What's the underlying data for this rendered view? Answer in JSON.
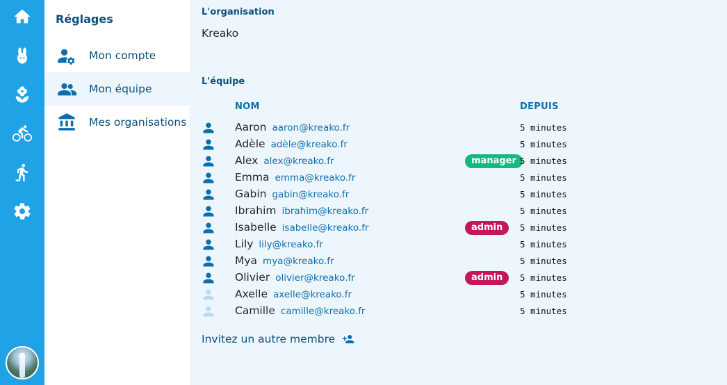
{
  "rail": {
    "items": [
      {
        "name": "home-icon"
      },
      {
        "name": "rabbit-icon"
      },
      {
        "name": "flower-icon"
      },
      {
        "name": "bicycle-icon"
      },
      {
        "name": "hiking-icon"
      },
      {
        "name": "settings-gear-icon"
      }
    ],
    "avatar": "avatar-image"
  },
  "sidebar": {
    "title": "Réglages",
    "items": [
      {
        "label": "Mon compte",
        "icon": "user-settings-icon",
        "active": false
      },
      {
        "label": "Mon équipe",
        "icon": "team-icon",
        "active": true
      },
      {
        "label": "Mes organisations",
        "icon": "bank-icon",
        "active": false
      }
    ]
  },
  "organisation": {
    "title": "L'organisation",
    "name": "Kreako"
  },
  "team": {
    "title": "L'équipe",
    "columns": {
      "name": "NOM",
      "since": "DEPUIS"
    },
    "members": [
      {
        "name": "Aaron",
        "email": "aaron@kreako.fr",
        "badge": "",
        "since": "5 minutes",
        "active": true
      },
      {
        "name": "Adèle",
        "email": "adèle@kreako.fr",
        "badge": "",
        "since": "5 minutes",
        "active": true
      },
      {
        "name": "Alex",
        "email": "alex@kreako.fr",
        "badge": "manager",
        "since": "5 minutes",
        "active": true
      },
      {
        "name": "Emma",
        "email": "emma@kreako.fr",
        "badge": "",
        "since": "5 minutes",
        "active": true
      },
      {
        "name": "Gabin",
        "email": "gabin@kreako.fr",
        "badge": "",
        "since": "5 minutes",
        "active": true
      },
      {
        "name": "Ibrahim",
        "email": "ibrahim@kreako.fr",
        "badge": "",
        "since": "5 minutes",
        "active": true
      },
      {
        "name": "Isabelle",
        "email": "isabelle@kreako.fr",
        "badge": "admin",
        "since": "5 minutes",
        "active": true
      },
      {
        "name": "Lily",
        "email": "lily@kreako.fr",
        "badge": "",
        "since": "5 minutes",
        "active": true
      },
      {
        "name": "Mya",
        "email": "mya@kreako.fr",
        "badge": "",
        "since": "5 minutes",
        "active": true
      },
      {
        "name": "Olivier",
        "email": "olivier@kreako.fr",
        "badge": "admin",
        "since": "5 minutes",
        "active": true
      },
      {
        "name": "Axelle",
        "email": "axelle@kreako.fr",
        "badge": "",
        "since": "5 minutes",
        "active": false
      },
      {
        "name": "Camille",
        "email": "camille@kreako.fr",
        "badge": "",
        "since": "5 minutes",
        "active": false
      }
    ],
    "invite_label": "Invitez un autre membre"
  },
  "colors": {
    "rail": "#1fa3e6",
    "accent": "#0b6fad",
    "manager_badge": "#13b981",
    "admin_badge": "#c2185b",
    "inactive_user": "#b7dcf2"
  }
}
